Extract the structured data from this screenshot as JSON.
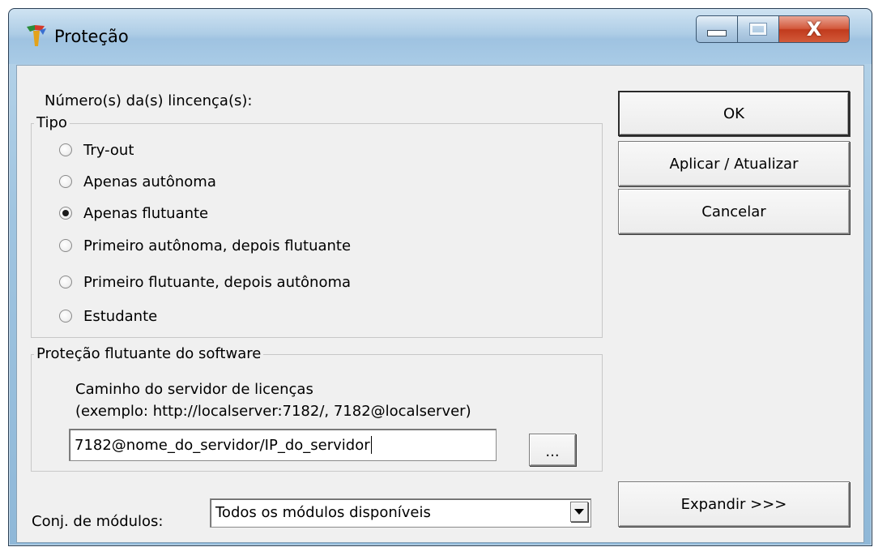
{
  "window": {
    "title": "Proteção",
    "icon": "app-logo-icon",
    "controls": {
      "minimize": "minimize-icon",
      "maximize": "maximize-icon",
      "close_glyph": "X"
    }
  },
  "licenses_label": "Número(s) da(s) lincença(s):",
  "tipo": {
    "title": "Tipo",
    "options": [
      {
        "label": "Try-out",
        "checked": false
      },
      {
        "label": "Apenas autônoma",
        "checked": false
      },
      {
        "label": "Apenas flutuante",
        "checked": true
      },
      {
        "label": "Primeiro autônoma, depois flutuante",
        "checked": false
      },
      {
        "label": "Primeiro flutuante, depois autônoma",
        "checked": false
      },
      {
        "label": "Estudante",
        "checked": false
      }
    ]
  },
  "floating": {
    "title": "Proteção flutuante do software",
    "path_label": "Caminho do servidor de licenças",
    "example_label": "(exemplo: http://localserver:7182/, 7182@localserver)",
    "server_value": "7182@nome_do_servidor/IP_do_servidor",
    "browse_label": "..."
  },
  "modules": {
    "label": "Conj. de módulos:",
    "selected": "Todos os módulos disponíveis"
  },
  "buttons": {
    "ok": "OK",
    "apply": "Aplicar / Atualizar",
    "cancel": "Cancelar",
    "expand": "Expandir >>>"
  }
}
